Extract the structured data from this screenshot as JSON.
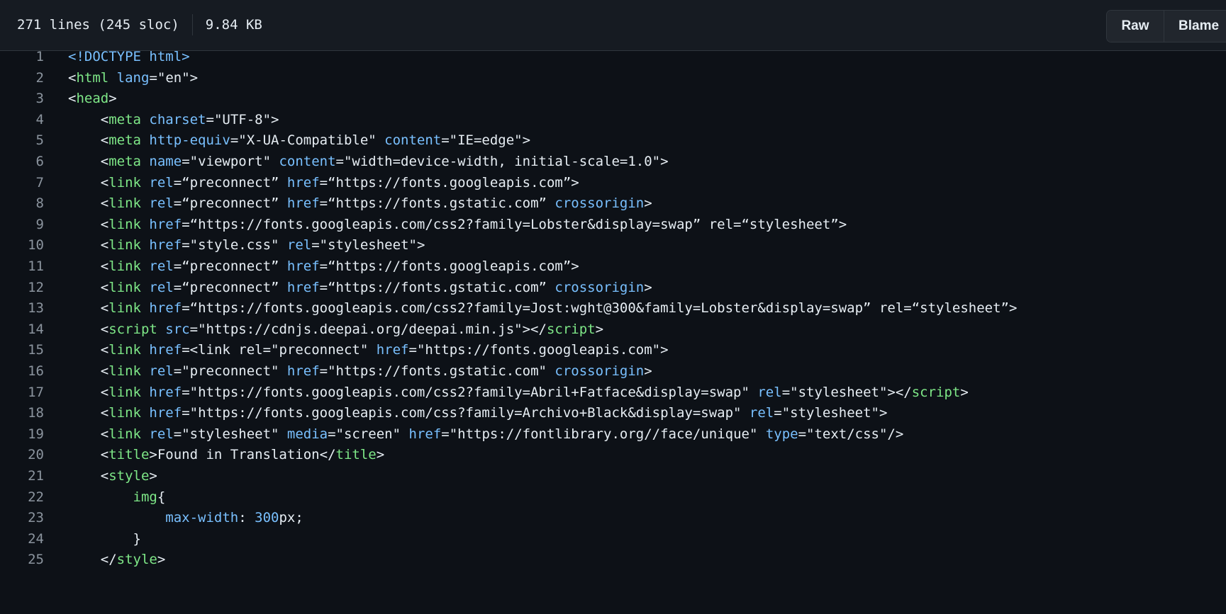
{
  "file": {
    "lines_info": "271 lines (245 sloc)",
    "size": "9.84 KB"
  },
  "toolbar": {
    "raw_label": "Raw",
    "blame_label": "Blame"
  },
  "code_lines": [
    {
      "n": "1",
      "tokens": [
        [
          "doc",
          "<!DOCTYPE html>"
        ]
      ]
    },
    {
      "n": "2",
      "tokens": [
        [
          "txt",
          "<"
        ],
        [
          "tag",
          "html"
        ],
        [
          "txt",
          " "
        ],
        [
          "attr",
          "lang"
        ],
        [
          "txt",
          "=\"en\">"
        ]
      ]
    },
    {
      "n": "3",
      "tokens": [
        [
          "txt",
          "<"
        ],
        [
          "tag",
          "head"
        ],
        [
          "txt",
          ">"
        ]
      ]
    },
    {
      "n": "4",
      "tokens": [
        [
          "txt",
          "    <"
        ],
        [
          "tag",
          "meta"
        ],
        [
          "txt",
          " "
        ],
        [
          "attr",
          "charset"
        ],
        [
          "txt",
          "=\"UTF-8\">"
        ]
      ]
    },
    {
      "n": "5",
      "tokens": [
        [
          "txt",
          "    <"
        ],
        [
          "tag",
          "meta"
        ],
        [
          "txt",
          " "
        ],
        [
          "attr",
          "http-equiv"
        ],
        [
          "txt",
          "=\"X-UA-Compatible\" "
        ],
        [
          "attr",
          "content"
        ],
        [
          "txt",
          "=\"IE=edge\">"
        ]
      ]
    },
    {
      "n": "6",
      "tokens": [
        [
          "txt",
          "    <"
        ],
        [
          "tag",
          "meta"
        ],
        [
          "txt",
          " "
        ],
        [
          "attr",
          "name"
        ],
        [
          "txt",
          "=\"viewport\" "
        ],
        [
          "attr",
          "content"
        ],
        [
          "txt",
          "=\"width=device-width, initial-scale=1.0\">"
        ]
      ]
    },
    {
      "n": "7",
      "tokens": [
        [
          "txt",
          "    <"
        ],
        [
          "tag",
          "link"
        ],
        [
          "txt",
          " "
        ],
        [
          "attr",
          "rel"
        ],
        [
          "txt",
          "=“preconnect” "
        ],
        [
          "attr",
          "href"
        ],
        [
          "txt",
          "=“https://fonts.googleapis.com”>"
        ]
      ]
    },
    {
      "n": "8",
      "tokens": [
        [
          "txt",
          "    <"
        ],
        [
          "tag",
          "link"
        ],
        [
          "txt",
          " "
        ],
        [
          "attr",
          "rel"
        ],
        [
          "txt",
          "=“preconnect” "
        ],
        [
          "attr",
          "href"
        ],
        [
          "txt",
          "=“https://fonts.gstatic.com” "
        ],
        [
          "attr",
          "crossorigin"
        ],
        [
          "txt",
          ">"
        ]
      ]
    },
    {
      "n": "9",
      "tokens": [
        [
          "txt",
          "    <"
        ],
        [
          "tag",
          "link"
        ],
        [
          "txt",
          " "
        ],
        [
          "attr",
          "href"
        ],
        [
          "txt",
          "=“https://fonts.googleapis.com/css2?family=Lobster&display=swap” rel=“stylesheet”>"
        ]
      ]
    },
    {
      "n": "10",
      "tokens": [
        [
          "txt",
          "    <"
        ],
        [
          "tag",
          "link"
        ],
        [
          "txt",
          " "
        ],
        [
          "attr",
          "href"
        ],
        [
          "txt",
          "=\"style.css\" "
        ],
        [
          "attr",
          "rel"
        ],
        [
          "txt",
          "=\"stylesheet\">"
        ]
      ]
    },
    {
      "n": "11",
      "tokens": [
        [
          "txt",
          "    <"
        ],
        [
          "tag",
          "link"
        ],
        [
          "txt",
          " "
        ],
        [
          "attr",
          "rel"
        ],
        [
          "txt",
          "=“preconnect” "
        ],
        [
          "attr",
          "href"
        ],
        [
          "txt",
          "=“https://fonts.googleapis.com”>"
        ]
      ]
    },
    {
      "n": "12",
      "tokens": [
        [
          "txt",
          "    <"
        ],
        [
          "tag",
          "link"
        ],
        [
          "txt",
          " "
        ],
        [
          "attr",
          "rel"
        ],
        [
          "txt",
          "=“preconnect” "
        ],
        [
          "attr",
          "href"
        ],
        [
          "txt",
          "=“https://fonts.gstatic.com” "
        ],
        [
          "attr",
          "crossorigin"
        ],
        [
          "txt",
          ">"
        ]
      ]
    },
    {
      "n": "13",
      "tokens": [
        [
          "txt",
          "    <"
        ],
        [
          "tag",
          "link"
        ],
        [
          "txt",
          " "
        ],
        [
          "attr",
          "href"
        ],
        [
          "txt",
          "=“https://fonts.googleapis.com/css2?family=Jost:wght@300&family=Lobster&display=swap” rel=“stylesheet”>"
        ]
      ]
    },
    {
      "n": "14",
      "tokens": [
        [
          "txt",
          "    <"
        ],
        [
          "tag",
          "script"
        ],
        [
          "txt",
          " "
        ],
        [
          "attr",
          "src"
        ],
        [
          "txt",
          "=\"https://cdnjs.deepai.org/deepai.min.js\"></"
        ],
        [
          "tag",
          "script"
        ],
        [
          "txt",
          ">"
        ]
      ]
    },
    {
      "n": "15",
      "tokens": [
        [
          "txt",
          "    <"
        ],
        [
          "tag",
          "link"
        ],
        [
          "txt",
          " "
        ],
        [
          "attr",
          "href"
        ],
        [
          "txt",
          "=<link rel=\"preconnect\" "
        ],
        [
          "attr",
          "href"
        ],
        [
          "txt",
          "=\"https://fonts.googleapis.com\">"
        ]
      ]
    },
    {
      "n": "16",
      "tokens": [
        [
          "txt",
          "    <"
        ],
        [
          "tag",
          "link"
        ],
        [
          "txt",
          " "
        ],
        [
          "attr",
          "rel"
        ],
        [
          "txt",
          "=\"preconnect\" "
        ],
        [
          "attr",
          "href"
        ],
        [
          "txt",
          "=\"https://fonts.gstatic.com\" "
        ],
        [
          "attr",
          "crossorigin"
        ],
        [
          "txt",
          ">"
        ]
      ]
    },
    {
      "n": "17",
      "tokens": [
        [
          "txt",
          "    <"
        ],
        [
          "tag",
          "link"
        ],
        [
          "txt",
          " "
        ],
        [
          "attr",
          "href"
        ],
        [
          "txt",
          "=\"https://fonts.googleapis.com/css2?family=Abril+Fatface&display=swap\" "
        ],
        [
          "attr",
          "rel"
        ],
        [
          "txt",
          "=\"stylesheet\"></"
        ],
        [
          "tag",
          "script"
        ],
        [
          "txt",
          ">"
        ]
      ]
    },
    {
      "n": "18",
      "tokens": [
        [
          "txt",
          "    <"
        ],
        [
          "tag",
          "link"
        ],
        [
          "txt",
          " "
        ],
        [
          "attr",
          "href"
        ],
        [
          "txt",
          "=\"https://fonts.googleapis.com/css?family=Archivo+Black&display=swap\" "
        ],
        [
          "attr",
          "rel"
        ],
        [
          "txt",
          "=\"stylesheet\">"
        ]
      ]
    },
    {
      "n": "19",
      "tokens": [
        [
          "txt",
          "    <"
        ],
        [
          "tag",
          "link"
        ],
        [
          "txt",
          " "
        ],
        [
          "attr",
          "rel"
        ],
        [
          "txt",
          "=\"stylesheet\" "
        ],
        [
          "attr",
          "media"
        ],
        [
          "txt",
          "=\"screen\" "
        ],
        [
          "attr",
          "href"
        ],
        [
          "txt",
          "=\"https://fontlibrary.org//face/unique\" "
        ],
        [
          "attr",
          "type"
        ],
        [
          "txt",
          "=\"text/css\"/>"
        ]
      ]
    },
    {
      "n": "20",
      "tokens": [
        [
          "txt",
          "    <"
        ],
        [
          "tag",
          "title"
        ],
        [
          "txt",
          ">Found in Translation</"
        ],
        [
          "tag",
          "title"
        ],
        [
          "txt",
          ">"
        ]
      ]
    },
    {
      "n": "21",
      "tokens": [
        [
          "txt",
          "    <"
        ],
        [
          "tag",
          "style"
        ],
        [
          "txt",
          ">"
        ]
      ]
    },
    {
      "n": "22",
      "tokens": [
        [
          "txt",
          "        "
        ],
        [
          "tag",
          "img"
        ],
        [
          "txt",
          "{"
        ]
      ]
    },
    {
      "n": "23",
      "tokens": [
        [
          "txt",
          "            "
        ],
        [
          "prop",
          "max-width"
        ],
        [
          "txt",
          ": "
        ],
        [
          "num",
          "300"
        ],
        [
          "txt",
          "px;"
        ]
      ]
    },
    {
      "n": "24",
      "tokens": [
        [
          "txt",
          "        }"
        ]
      ]
    },
    {
      "n": "25",
      "tokens": [
        [
          "txt",
          "    </"
        ],
        [
          "tag",
          "style"
        ],
        [
          "txt",
          ">"
        ]
      ]
    }
  ]
}
